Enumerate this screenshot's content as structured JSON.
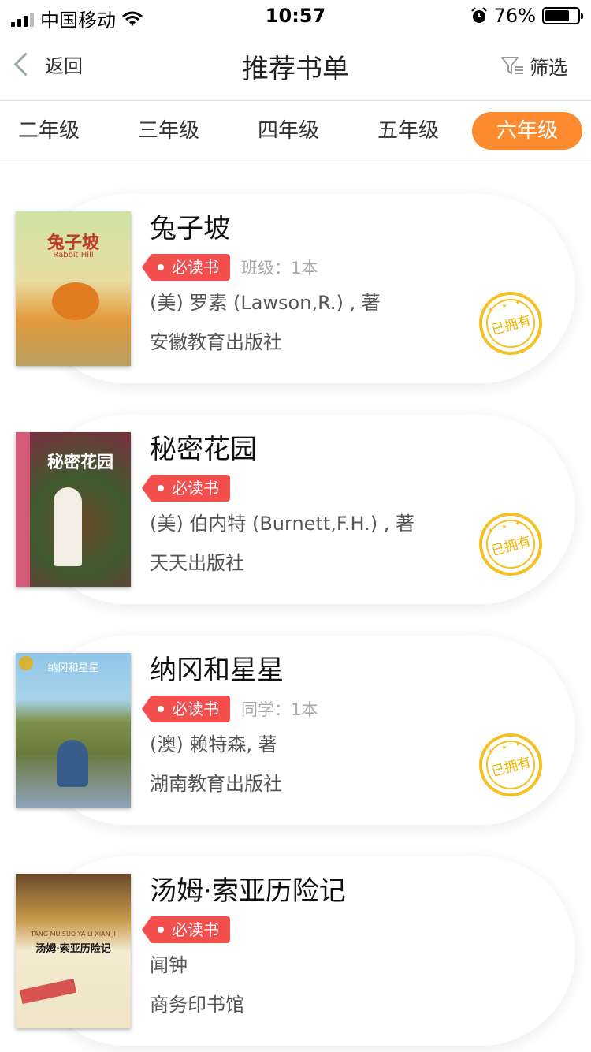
{
  "status": {
    "carrier": "中国移动",
    "time": "10:57",
    "battery": "76%",
    "battery_level": 0.76
  },
  "nav": {
    "back": "返回",
    "title": "推荐书单",
    "filter": "筛选"
  },
  "tabs": [
    "二年级",
    "三年级",
    "四年级",
    "五年级",
    "六年级"
  ],
  "active_tab": 4,
  "books": [
    {
      "title": "兔子坡",
      "tag": "必读书",
      "extra": "班级：1本",
      "author": "(美) 罗素 (Lawson,R.) , 著",
      "publisher": "安徽教育出版社",
      "owned": "已拥有",
      "cover_text": "兔子坡",
      "cover_sub": "Rabbit Hill"
    },
    {
      "title": "秘密花园",
      "tag": "必读书",
      "extra": "",
      "author": "(美) 伯内特 (Burnett,F.H.) , 著",
      "publisher": "天天出版社",
      "owned": "已拥有",
      "cover_text": "秘密花园",
      "cover_sub": ""
    },
    {
      "title": "纳冈和星星",
      "tag": "必读书",
      "extra": "同学：1本",
      "author": "(澳) 赖特森, 著",
      "publisher": "湖南教育出版社",
      "owned": "已拥有",
      "cover_text": "纳冈和星星",
      "cover_sub": ""
    },
    {
      "title": "汤姆·索亚历险记",
      "tag": "必读书",
      "extra": "",
      "author": "闻钟",
      "publisher": "商务印书馆",
      "owned": "",
      "cover_text": "汤姆·索亚历险记",
      "cover_sub": "TANG MU SUO YA LI XIAN JI"
    }
  ],
  "colors": {
    "accent": "#fb8b2e",
    "tag": "#f24e4e",
    "stamp": "#f5c024"
  }
}
